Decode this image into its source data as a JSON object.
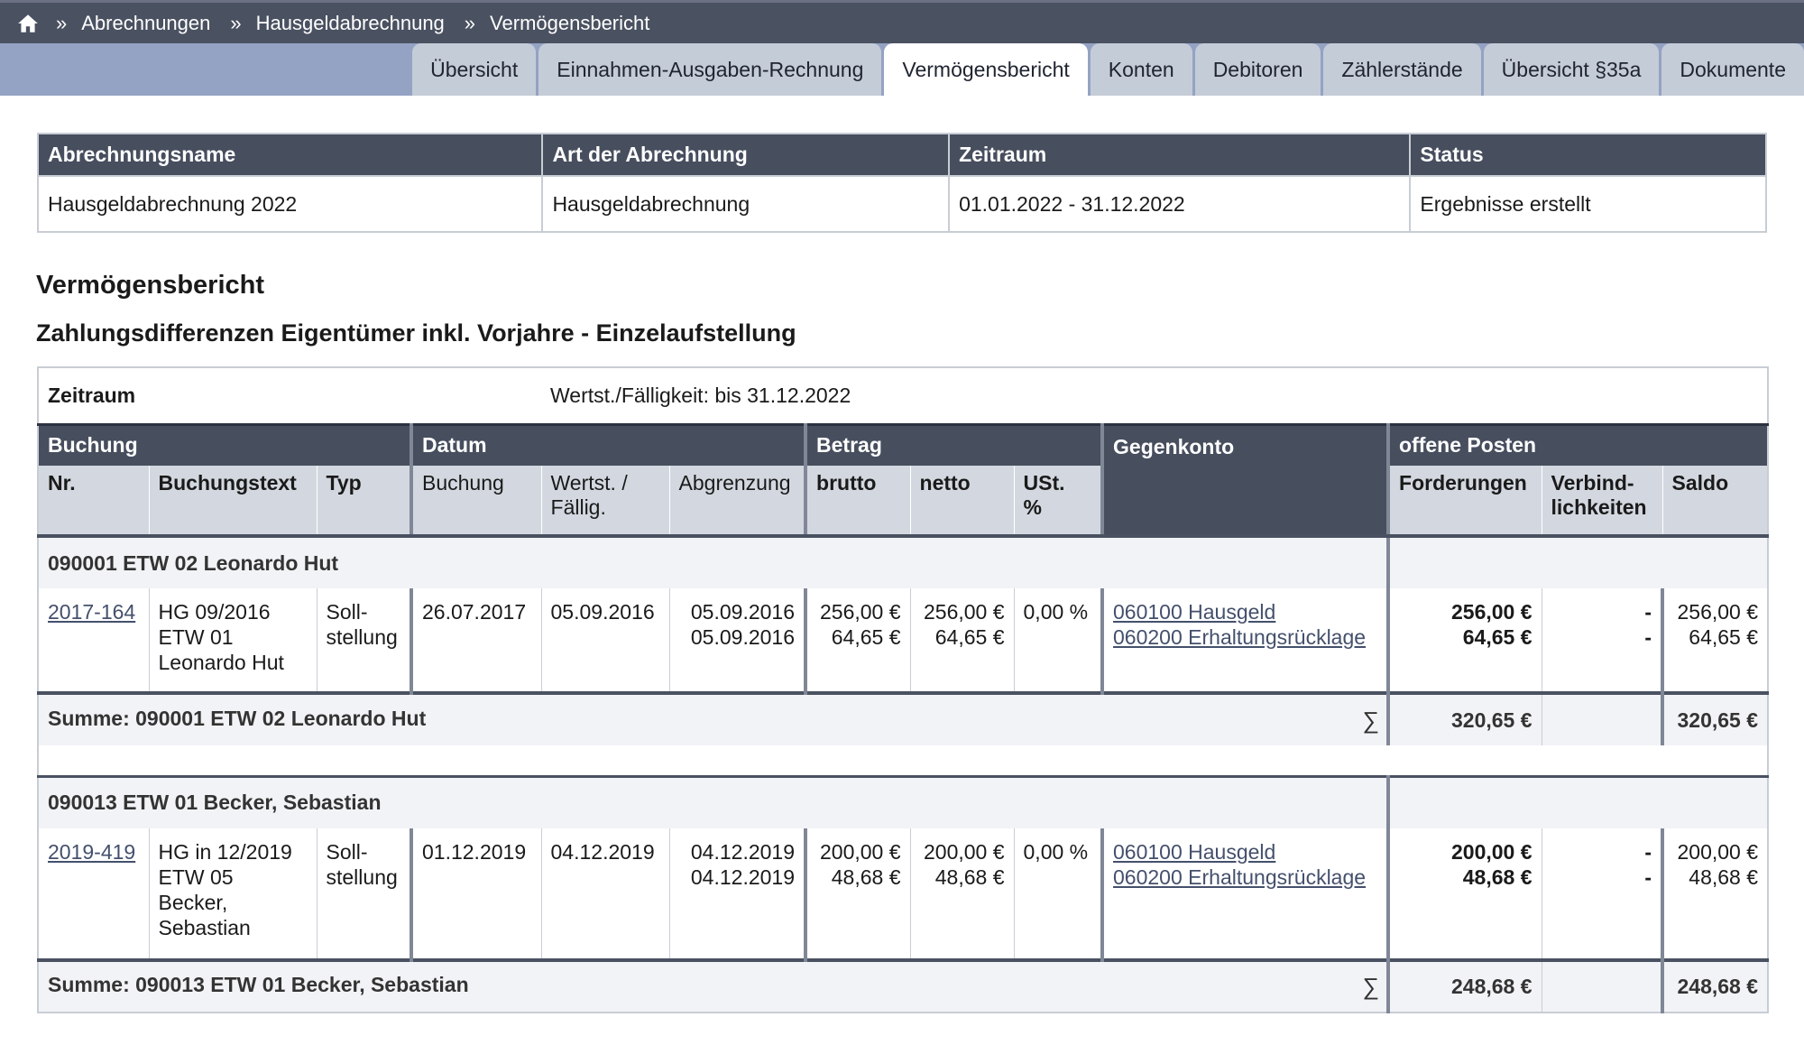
{
  "breadcrumb": {
    "separator": "»",
    "items": [
      "Abrechnungen",
      "Hausgeldabrechnung",
      "Vermögensbericht"
    ]
  },
  "tabs": [
    {
      "label": "Übersicht",
      "active": false
    },
    {
      "label": "Einnahmen-Ausgaben-Rechnung",
      "active": false
    },
    {
      "label": "Vermögensbericht",
      "active": true
    },
    {
      "label": "Konten",
      "active": false
    },
    {
      "label": "Debitoren",
      "active": false
    },
    {
      "label": "Zählerstände",
      "active": false
    },
    {
      "label": "Übersicht §35a",
      "active": false
    },
    {
      "label": "Dokumente",
      "active": false
    }
  ],
  "info": {
    "headers": [
      "Abrechnungsname",
      "Art der Abrechnung",
      "Zeitraum",
      "Status"
    ],
    "values": [
      "Hausgeldabrechnung 2022",
      "Hausgeldabrechnung",
      "01.01.2022 - 31.12.2022",
      "Ergebnisse erstellt"
    ]
  },
  "section_title": "Vermögensbericht",
  "section_subtitle": "Zahlungsdifferenzen Eigentümer inkl. Vorjahre - Einzelaufstellung",
  "period": {
    "label": "Zeitraum",
    "value": "Wertst./Fälligkeit: bis 31.12.2022"
  },
  "table": {
    "groups": [
      "Buchung",
      "Datum",
      "Betrag",
      "Gegenkonto",
      "offene Posten"
    ],
    "columns": {
      "nr": "Nr.",
      "buchungstext": "Buchungstext",
      "typ": "Typ",
      "buchung": "Buchung",
      "wertst_1": "Wertst. /",
      "wertst_2": "Fällig.",
      "abgrenzung": "Abgrenzung",
      "brutto": "brutto",
      "netto": "netto",
      "ust_1": "USt.",
      "ust_2": "%",
      "forderungen": "Forderungen",
      "verb_1": "Verbind-",
      "verb_2": "lichkeiten",
      "saldo": "Saldo"
    },
    "sum_symbol": "∑",
    "owners": [
      {
        "title": "090001 ETW 02 Leonardo Hut",
        "row": {
          "nr": "2017-164",
          "text": [
            "HG 09/2016",
            "ETW 01",
            "Leonardo Hut"
          ],
          "typ": [
            "Soll-",
            "stellung"
          ],
          "buchung": "26.07.2017",
          "wertst": "05.09.2016",
          "abgrenzung": [
            "05.09.2016",
            "05.09.2016"
          ],
          "brutto": [
            "256,00 €",
            "64,65 €"
          ],
          "netto": [
            "256,00 €",
            "64,65 €"
          ],
          "ust": "0,00 %",
          "gegenkonto": [
            "060100 Hausgeld",
            "060200 Erhaltungsrücklage"
          ],
          "forderungen": [
            "256,00 €",
            "64,65 €"
          ],
          "verbindlichkeiten": [
            "-",
            "-"
          ],
          "saldo": [
            "256,00 €",
            "64,65 €"
          ]
        },
        "sum_label": "Summe: 090001 ETW 02 Leonardo Hut",
        "sum_forderungen": "320,65 €",
        "sum_saldo": "320,65 €"
      },
      {
        "title": "090013 ETW 01 Becker, Sebastian",
        "row": {
          "nr": "2019-419",
          "text": [
            "HG in 12/2019",
            "ETW 05",
            "Becker,",
            "Sebastian"
          ],
          "typ": [
            "Soll-",
            "stellung"
          ],
          "buchung": "01.12.2019",
          "wertst": "04.12.2019",
          "abgrenzung": [
            "04.12.2019",
            "04.12.2019"
          ],
          "brutto": [
            "200,00 €",
            "48,68 €"
          ],
          "netto": [
            "200,00 €",
            "48,68 €"
          ],
          "ust": "0,00 %",
          "gegenkonto": [
            "060100 Hausgeld",
            "060200 Erhaltungsrücklage"
          ],
          "forderungen": [
            "200,00 €",
            "48,68 €"
          ],
          "verbindlichkeiten": [
            "-",
            "-"
          ],
          "saldo": [
            "200,00 €",
            "48,68 €"
          ]
        },
        "sum_label": "Summe: 090013 ETW 01 Becker, Sebastian",
        "sum_forderungen": "248,68 €",
        "sum_saldo": "248,68 €"
      }
    ]
  }
}
